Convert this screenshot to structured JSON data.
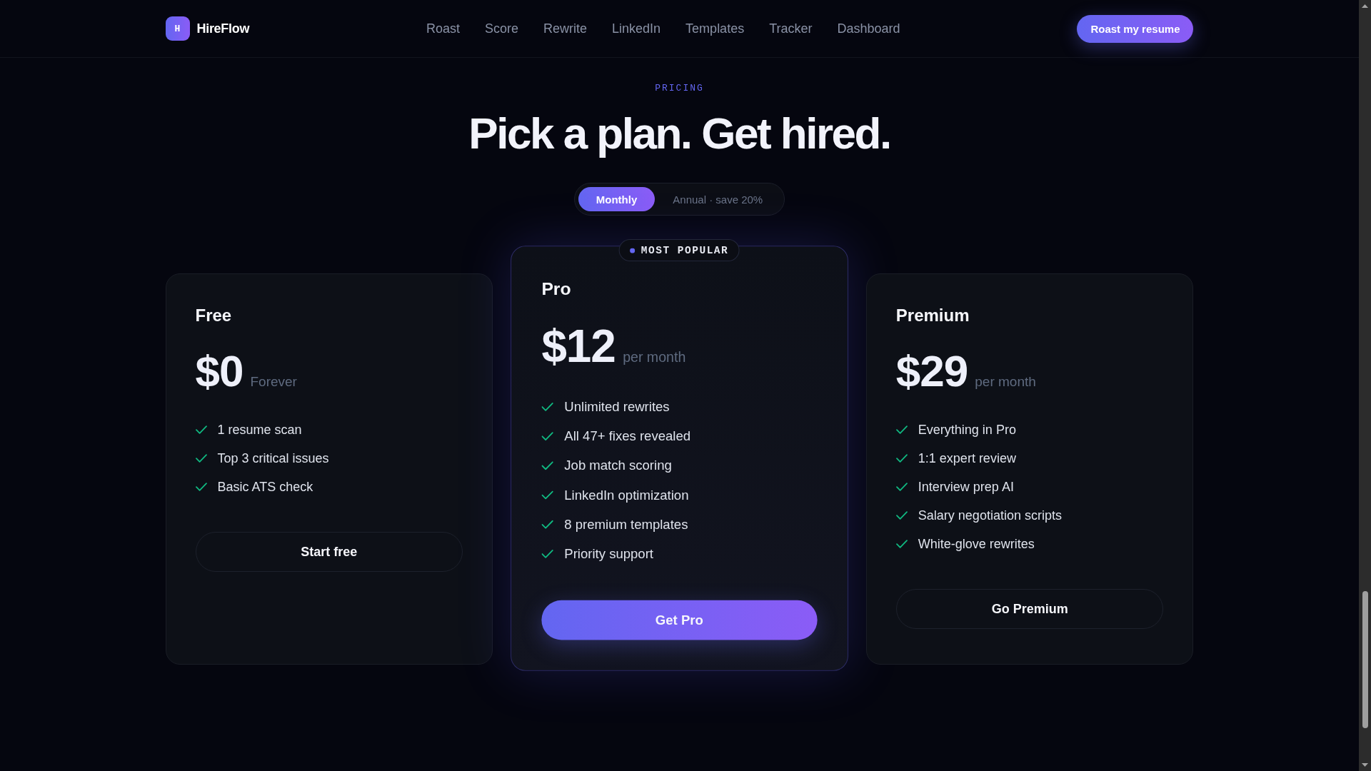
{
  "header": {
    "logo": {
      "mark": "H",
      "name": "HireFlow"
    },
    "nav": [
      "Roast",
      "Score",
      "Rewrite",
      "LinkedIn",
      "Templates",
      "Tracker",
      "Dashboard"
    ],
    "cta": "Roast my resume"
  },
  "pricing": {
    "eyebrow": "PRICING",
    "title": "Pick a plan. Get hired.",
    "billing_toggle": [
      {
        "label": "Monthly",
        "selected": true
      },
      {
        "label": "Annual · save 20%",
        "selected": false
      }
    ],
    "plans": [
      {
        "name": "Free",
        "price": "$0",
        "period": "Forever",
        "featured": false,
        "features": [
          "1 resume scan",
          "Top 3 critical issues",
          "Basic ATS check"
        ],
        "button": "Start free"
      },
      {
        "name": "Pro",
        "price": "$12",
        "period": "per month",
        "featured": true,
        "badge": "MOST POPULAR",
        "features": [
          "Unlimited rewrites",
          "All 47+ fixes revealed",
          "Job match scoring",
          "LinkedIn optimization",
          "8 premium templates",
          "Priority support"
        ],
        "button": "Get Pro"
      },
      {
        "name": "Premium",
        "price": "$29",
        "period": "per month",
        "featured": false,
        "features": [
          "Everything in Pro",
          "1:1 expert review",
          "Interview prep AI",
          "Salary negotiation scripts",
          "White-glove rewrites"
        ],
        "button": "Go Premium"
      }
    ]
  }
}
